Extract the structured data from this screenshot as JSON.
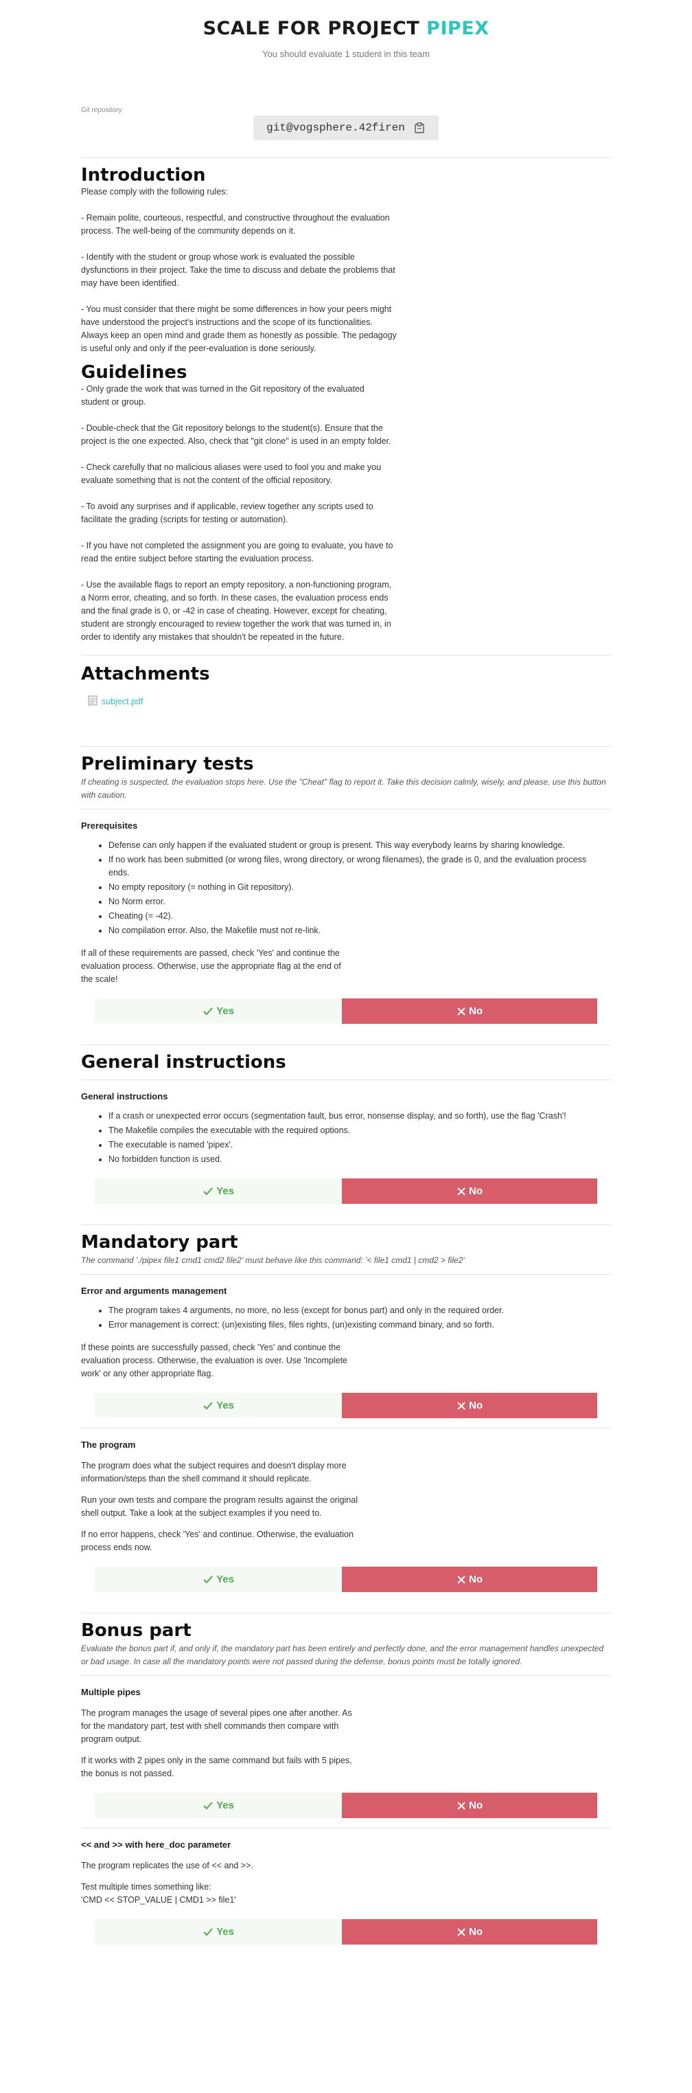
{
  "header": {
    "title_prefix": "SCALE FOR PROJECT",
    "project": "PIPEX",
    "subtitle": "You should evaluate 1 student in this team"
  },
  "git": {
    "label": "Git repository",
    "url": "git@vogsphere.42firen",
    "copy_icon": "clipboard-icon"
  },
  "introduction": {
    "title": "Introduction",
    "lead": "Please comply with the following rules:",
    "p1": "- Remain polite, courteous, respectful, and constructive throughout the evaluation process. The well-being of the community depends on it.",
    "p2": "- Identify with the student or group whose work is evaluated the possible dysfunctions in their project. Take the time to discuss and debate the problems that may have been identified.",
    "p3": "- You must consider that there might be some differences in how your peers might have understood the project's instructions and the scope of its functionalities. Always keep an open mind and grade them as honestly as possible. The pedagogy is useful only and only if the peer-evaluation is done seriously."
  },
  "guidelines": {
    "title": "Guidelines",
    "p1": "- Only grade the work that was turned in the Git repository of the evaluated student or group.",
    "p2": "- Double-check that the Git repository belongs to the student(s). Ensure that the project is the one expected. Also, check that \"git clone\" is used in an empty folder.",
    "p3": "- Check carefully that no malicious aliases were used to fool you and make you evaluate something that is not the content of the official repository.",
    "p4": "- To avoid any surprises and if applicable, review together any scripts used to facilitate the grading (scripts for testing or automation).",
    "p5": "- If you have not completed the assignment you are going to evaluate, you have to read the entire subject before starting the evaluation process.",
    "p6": "- Use the available flags to report an empty repository, a non-functioning program, a Norm error, cheating, and so forth. In these cases, the evaluation process ends and the final grade is 0, or -42 in case of cheating. However, except for cheating, student are strongly encouraged to review together the work that was turned in, in order to identify any mistakes that shouldn't be repeated in the future."
  },
  "attachments": {
    "title": "Attachments",
    "file": "subject.pdf"
  },
  "buttons": {
    "yes": "Yes",
    "no": "No"
  },
  "preliminary": {
    "title": "Preliminary tests",
    "note": "If cheating is suspected, the evaluation stops here. Use the \"Cheat\" flag to report it. Take this decision calmly, wisely, and please, use this button with caution.",
    "sub": "Prerequisites",
    "items": [
      "Defense can only happen if the evaluated student or group is present. This way everybody learns by sharing knowledge.",
      "If no work has been submitted (or wrong files, wrong directory, or wrong filenames), the grade is 0, and the evaluation process ends.",
      "No empty repository (= nothing in Git repository).",
      "No Norm error.",
      "Cheating (= -42).",
      "No compilation error. Also, the Makefile must not re-link."
    ],
    "after": "If all of these requirements are passed, check 'Yes' and continue the evaluation process. Otherwise, use the appropriate flag at the end of the scale!"
  },
  "general": {
    "title": "General instructions",
    "sub": "General instructions",
    "items": [
      "If a crash or unexpected error occurs (segmentation fault, bus error, nonsense display, and so forth), use the flag 'Crash'!",
      "The Makefile compiles the executable with the required options.",
      "The executable is named 'pipex'.",
      "No forbidden function is used."
    ]
  },
  "mandatory": {
    "title": "Mandatory part",
    "note": "The command './pipex file1 cmd1 cmd2 file2' must behave like this command: '< file1 cmd1 | cmd2 > file2'",
    "errors": {
      "sub": "Error and arguments management",
      "items": [
        "The program takes 4 arguments, no more, no less (except for bonus part) and only in the required order.",
        "Error management is correct: (un)existing files, files rights, (un)existing command binary, and so forth."
      ],
      "after": "If these points are successfully passed, check 'Yes' and continue the evaluation process. Otherwise, the evaluation is over. Use 'Incomplete work' or any other appropriate flag."
    },
    "program": {
      "sub": "The program",
      "p1": "The program does what the subject requires and doesn't display more information/steps than the shell command it should replicate.",
      "p2": "Run your own tests and compare the program results against the original shell output. Take a look at the subject examples if you need to.",
      "p3": "If no error happens, check 'Yes' and continue. Otherwise, the evaluation process ends now."
    }
  },
  "bonus": {
    "title": "Bonus part",
    "note": "Evaluate the bonus part if, and only if, the mandatory part has been entirely and perfectly done, and the error management handles unexpected or bad usage. In case all the mandatory points were not passed during the defense, bonus points must be totally ignored.",
    "pipes": {
      "sub": "Multiple pipes",
      "p1": "The program manages the usage of several pipes one after another. As for the mandatory part, test with shell commands then compare with program output.",
      "p2": "If it works with 2 pipes only in the same command but fails with 5 pipes, the bonus is not passed."
    },
    "heredoc": {
      "sub": "<< and >> with here_doc parameter",
      "p1": "The program replicates the use of << and >>.",
      "p2a": "Test multiple times something like:",
      "p2b": "'CMD << STOP_VALUE | CMD1 >> file1'"
    }
  }
}
